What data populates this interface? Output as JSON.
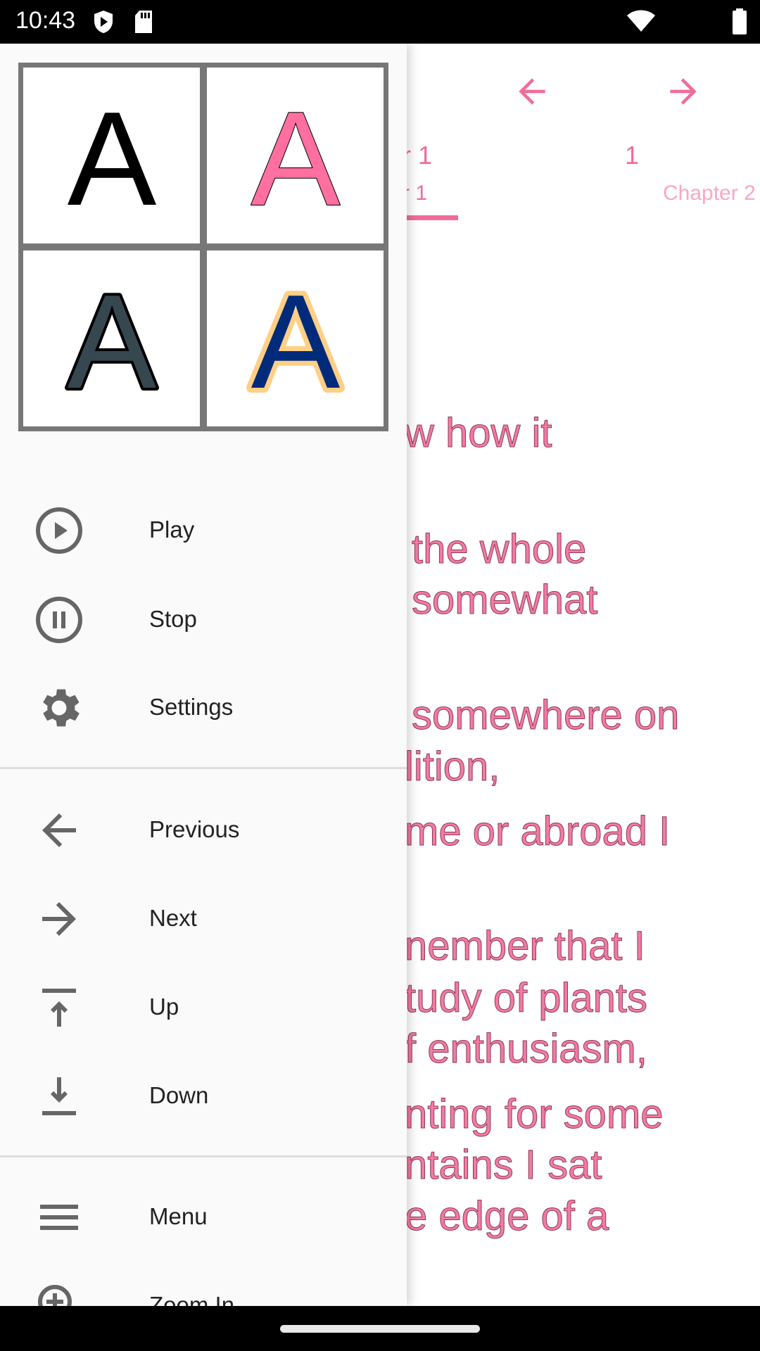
{
  "status_bar": {
    "time": "10:43",
    "icons": [
      "shield-icon",
      "sd-card-icon",
      "wifi-icon",
      "battery-icon"
    ]
  },
  "reader": {
    "prev_icon": "arrow-left-icon",
    "next_icon": "arrow-right-icon",
    "tabs": [
      {
        "title": "r 1",
        "subtitle": "r 1",
        "selected": true
      },
      {
        "title": "1",
        "subtitle": "Chapter 2",
        "selected": false
      }
    ],
    "lines": [
      "w how it",
      "the whole",
      "somewhat",
      "somewhere on",
      "lition,",
      "me or abroad I",
      "nember that I",
      "tudy of plants",
      "f enthusiasm,",
      "nting for some",
      "ntains I sat",
      "e edge of a"
    ],
    "accent": "#f06c9b"
  },
  "drawer": {
    "font_styles": [
      {
        "letter": "A",
        "fill": "#000000",
        "stroke": "none"
      },
      {
        "letter": "A",
        "fill": "#ff6fa0",
        "stroke": "#000000"
      },
      {
        "letter": "A",
        "fill": "#37474f",
        "stroke": "#000000"
      },
      {
        "letter": "A",
        "fill": "#002a7a",
        "stroke": "#ffcf85"
      }
    ],
    "group1": [
      {
        "label": "Play",
        "icon": "play-circle-icon"
      },
      {
        "label": "Stop",
        "icon": "pause-circle-icon"
      },
      {
        "label": "Settings",
        "icon": "gear-icon"
      }
    ],
    "group2": [
      {
        "label": "Previous",
        "icon": "arrow-left-icon"
      },
      {
        "label": "Next",
        "icon": "arrow-right-icon"
      },
      {
        "label": "Up",
        "icon": "arrow-up-to-top-icon"
      },
      {
        "label": "Down",
        "icon": "arrow-down-to-bottom-icon"
      }
    ],
    "group3": [
      {
        "label": "Menu",
        "icon": "menu-icon"
      },
      {
        "label": "Zoom In",
        "icon": "zoom-in-icon"
      }
    ]
  }
}
